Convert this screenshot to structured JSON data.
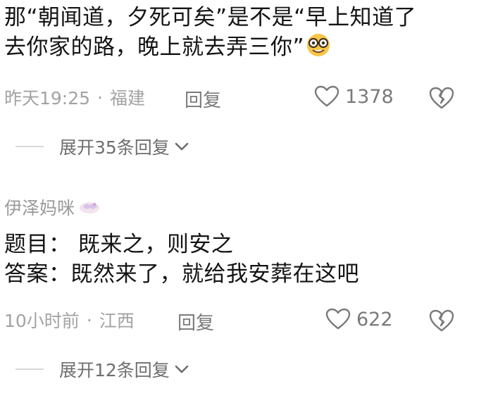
{
  "comment1": {
    "line1": "那“朝闻道，夕死可矣”是不是“早上知道了",
    "line2": "去你家的路，晚上就去弄三你”",
    "emoji": "nerd-face-emoji",
    "time": "昨天19:25",
    "location": "福建",
    "reply": "回复",
    "likes": "1378",
    "expand": "展开35条回复"
  },
  "comment2": {
    "username": "伊泽妈咪",
    "line1": "题目： 既来之，则安之",
    "line2": "答案：既然来了，就给我安葬在这吧",
    "time": "10小时前",
    "location": "江西",
    "reply": "回复",
    "likes": "622",
    "expand": "展开12条回复"
  },
  "colors": {
    "text": "#141414",
    "meta": "#a3a3a3",
    "icon": "#7a7a7a",
    "emoji": "#f7c548"
  }
}
